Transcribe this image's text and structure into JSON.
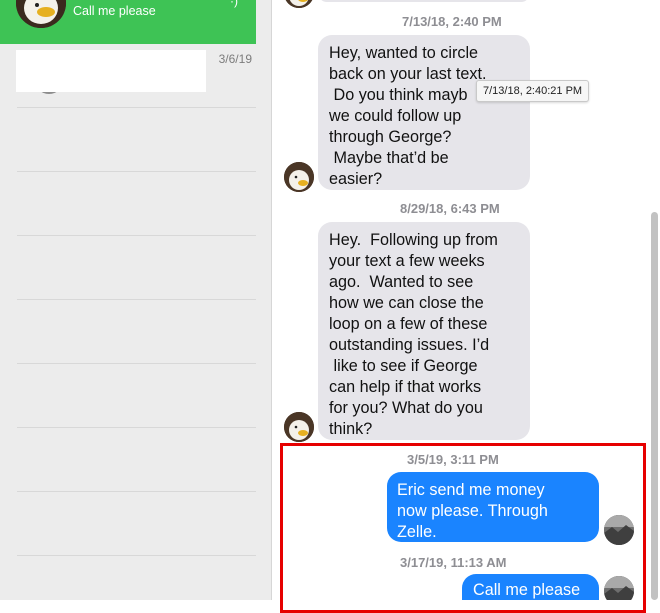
{
  "sidebar": {
    "active_conversation": {
      "preview": "Call me please"
    },
    "conversations": [
      {
        "date": "3/6/19"
      }
    ]
  },
  "chat": {
    "messages": [
      {
        "timestamp": "7/13/18, 2:40 PM",
        "direction": "incoming",
        "lines": [
          "Hey, wanted to circle",
          "back on your last text.",
          " Do you think mayb",
          "we could follow up",
          "through George?",
          " Maybe that’d be",
          "easier?"
        ]
      },
      {
        "timestamp": "8/29/18, 6:43 PM",
        "direction": "incoming",
        "lines": [
          "Hey.  Following up from",
          "your text a few weeks",
          "ago.  Wanted to see",
          "how we can close the",
          "loop on a few of these",
          "outstanding issues. I’d",
          " like to see if George",
          "can help if that works",
          "for you? What do you",
          "think?"
        ]
      },
      {
        "timestamp": "3/5/19, 3:11 PM",
        "direction": "outgoing",
        "lines": [
          "Eric send me money",
          "now please. Through",
          "Zelle."
        ]
      },
      {
        "timestamp": "3/17/19, 11:13 AM",
        "direction": "outgoing",
        "lines": [
          "Call me please"
        ]
      }
    ],
    "tooltip": "7/13/18, 2:40:21 PM"
  },
  "colors": {
    "sidebar_active": "#3ec355",
    "bubble_incoming": "#e6e5ea",
    "bubble_outgoing": "#1a84ff",
    "highlight_border": "#e60000"
  },
  "icons": {
    "contact_avatar": "eagle-avatar-icon",
    "self_avatar": "user-avatar-icon"
  }
}
